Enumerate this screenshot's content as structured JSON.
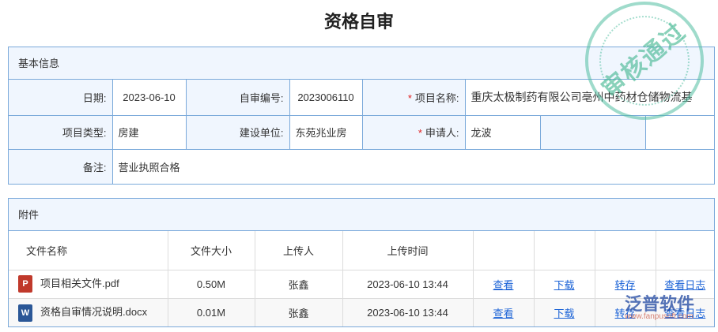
{
  "title": "资格自审",
  "basic": {
    "header": "基本信息",
    "date_label": "日期:",
    "date": "2023-06-10",
    "code_label": "自审编号:",
    "code": "2023006110",
    "project_label": "项目名称:",
    "project": "重庆太极制药有限公司亳州中药材仓储物流基",
    "type_label": "项目类型:",
    "type": "房建",
    "unit_label": "建设单位:",
    "unit": "东苑兆业房",
    "applicant_label": "申请人:",
    "applicant": "龙波",
    "note_label": "备注:",
    "note": "营业执照合格",
    "required_mark": "*"
  },
  "attach": {
    "header": "附件",
    "columns": [
      "文件名称",
      "文件大小",
      "上传人",
      "上传时间"
    ],
    "files": [
      {
        "icon": "pdf-icon",
        "icon_text": "P",
        "name": "项目相关文件.pdf",
        "size": "0.50M",
        "uploader": "张鑫",
        "time": "2023-06-10 13:44"
      },
      {
        "icon": "word-icon",
        "icon_text": "W",
        "name": "资格自审情况说明.docx",
        "size": "0.01M",
        "uploader": "张鑫",
        "time": "2023-06-10 13:44"
      }
    ],
    "actions": [
      "查看",
      "下载",
      "转存",
      "查看日志"
    ]
  },
  "stamp": "审核通过",
  "watermark": {
    "name": "泛普软件",
    "url": "www.fanpusoft.com"
  }
}
